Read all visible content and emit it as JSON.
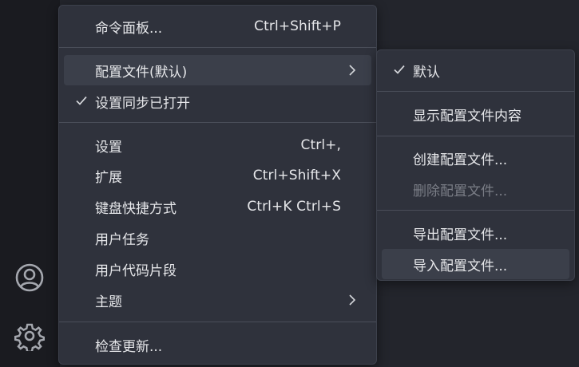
{
  "main_menu": {
    "command_palette": {
      "label": "命令面板...",
      "shortcut": "Ctrl+Shift+P"
    },
    "profile": {
      "label": "配置文件(默认)"
    },
    "settings_sync": {
      "label": "设置同步已打开"
    },
    "settings": {
      "label": "设置",
      "shortcut": "Ctrl+,"
    },
    "extensions": {
      "label": "扩展",
      "shortcut": "Ctrl+Shift+X"
    },
    "keyboard_shortcuts": {
      "label": "键盘快捷方式",
      "shortcut": "Ctrl+K Ctrl+S"
    },
    "user_tasks": {
      "label": "用户任务"
    },
    "user_snippets": {
      "label": "用户代码片段"
    },
    "themes": {
      "label": "主题"
    },
    "check_updates": {
      "label": "检查更新..."
    }
  },
  "profile_submenu": {
    "default": {
      "label": "默认"
    },
    "show_contents": {
      "label": "显示配置文件内容"
    },
    "create": {
      "label": "创建配置文件..."
    },
    "delete": {
      "label": "删除配置文件..."
    },
    "export": {
      "label": "导出配置文件..."
    },
    "import": {
      "label": "导入配置文件..."
    }
  },
  "activity_bar": {
    "icons": [
      "account-icon",
      "manage-gear-icon"
    ]
  }
}
